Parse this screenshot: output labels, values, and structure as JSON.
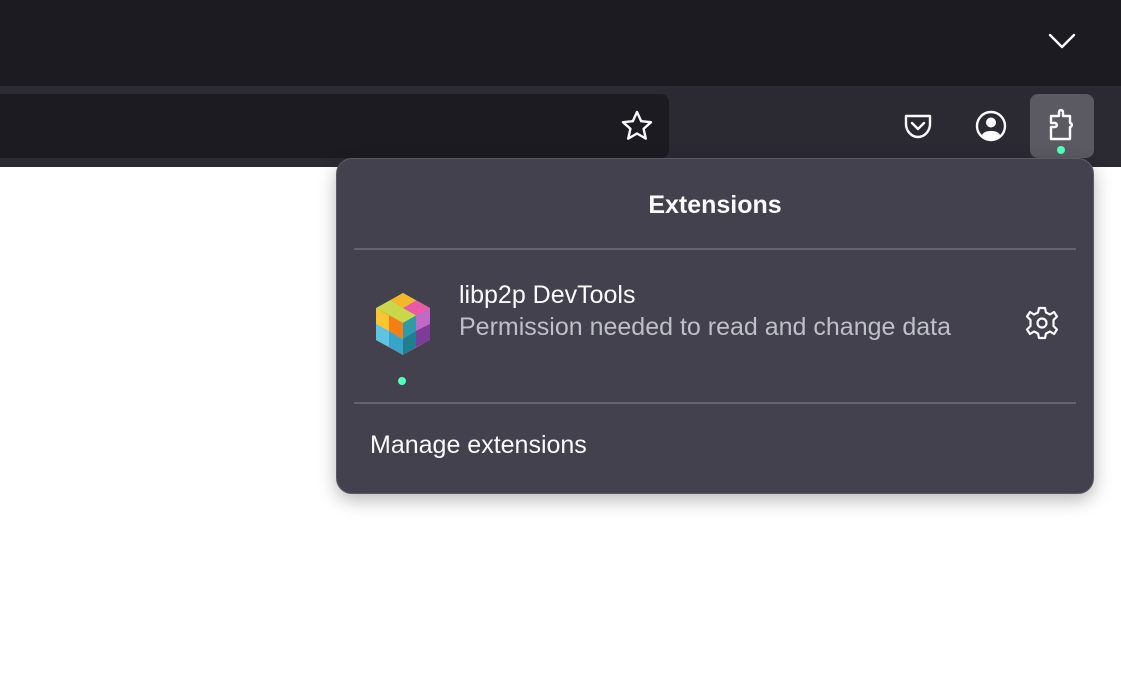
{
  "toolbar": {
    "tab_list_icon": "chevron-down-icon",
    "bookmark_icon": "star-icon",
    "pocket_icon": "pocket-icon",
    "account_icon": "account-icon",
    "extensions_icon": "puzzle-piece-icon"
  },
  "panel": {
    "title": "Extensions",
    "extensions": [
      {
        "name": "libp2p DevTools",
        "message": "Permission needed to read and change data",
        "icon": "libp2p-cube-icon",
        "settings_icon": "gear-icon"
      }
    ],
    "manage_label": "Manage extensions"
  },
  "colors": {
    "tabbar_bg": "#1c1b22",
    "toolbar_bg": "#2b2a33",
    "panel_bg": "#42414d",
    "active_button_bg": "#5b5a62",
    "attention_dot": "#54ffbd",
    "text_primary": "#fbfbfe",
    "text_secondary": "#bfbfc9"
  }
}
